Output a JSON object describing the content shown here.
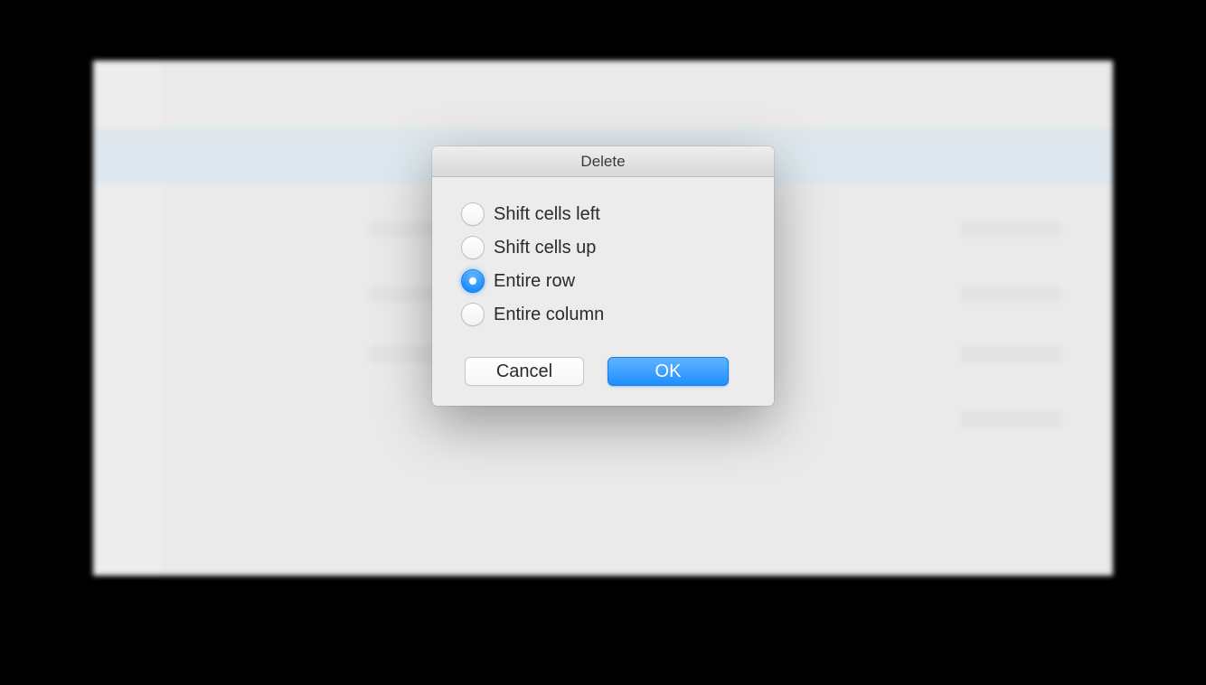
{
  "dialog": {
    "title": "Delete",
    "options": [
      {
        "label": "Shift cells left",
        "selected": false
      },
      {
        "label": "Shift cells up",
        "selected": false
      },
      {
        "label": "Entire row",
        "selected": true
      },
      {
        "label": "Entire column",
        "selected": false
      }
    ],
    "buttons": {
      "cancel": "Cancel",
      "ok": "OK"
    }
  }
}
